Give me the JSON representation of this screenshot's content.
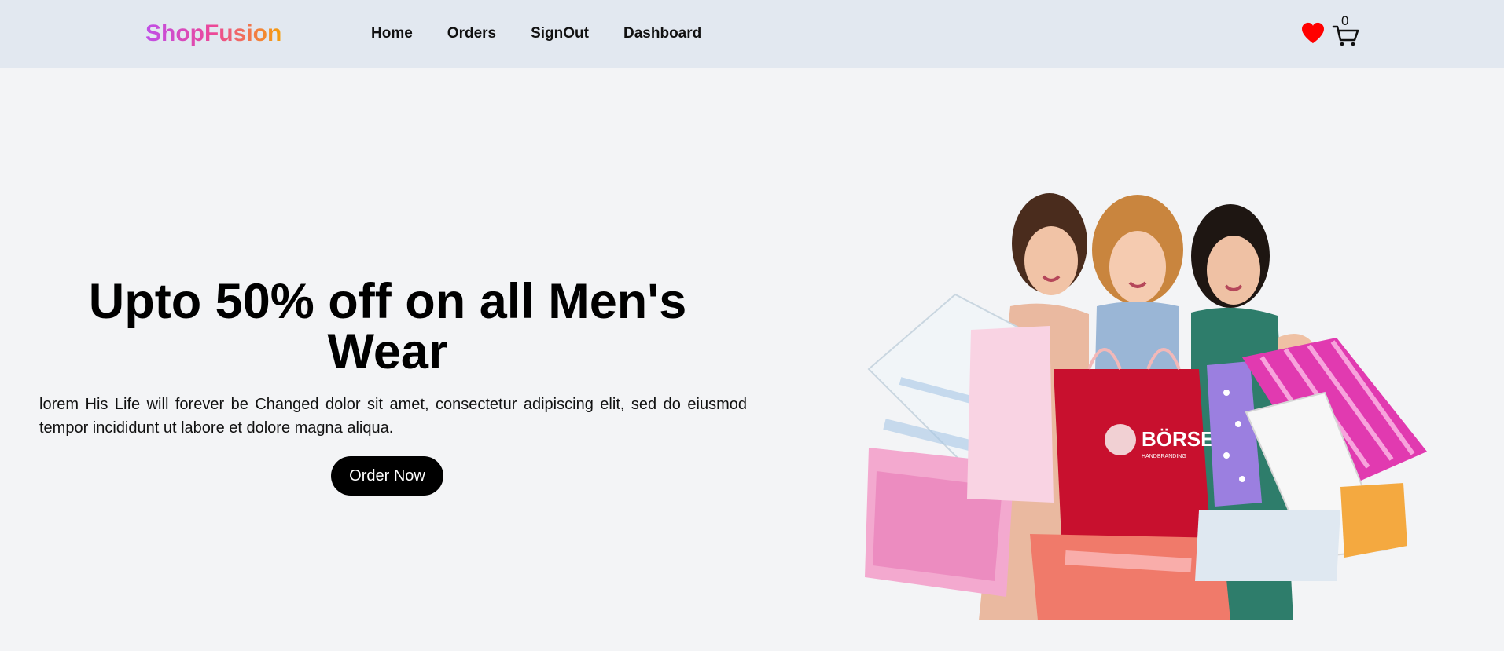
{
  "navbar": {
    "logo": "ShopFusion",
    "links": [
      {
        "label": "Home"
      },
      {
        "label": "Orders"
      },
      {
        "label": "SignOut"
      },
      {
        "label": "Dashboard"
      }
    ],
    "wishlist_icon": "heart-icon",
    "cart_icon": "cart-icon",
    "cart_count": "0",
    "colors": {
      "background": "#e2e8f0",
      "logo_gradient": [
        "#c04ee8",
        "#ec4899",
        "#f59e0b"
      ],
      "heart": "#ff0000"
    }
  },
  "hero": {
    "title": "Upto 50% off on all Men's Wear",
    "description": "lorem His Life will forever be Changed dolor sit amet, consectetur adipiscing elit, sed do eiusmod tempor incididunt ut labore et dolore magna aliqua.",
    "cta_label": "Order Now",
    "image_brand_text": "BÖRSE",
    "image_brand_subtext": "HANDBRANDING",
    "colors": {
      "page_background": "#f3f4f6",
      "cta_background": "#000000",
      "cta_text": "#ffffff"
    }
  }
}
